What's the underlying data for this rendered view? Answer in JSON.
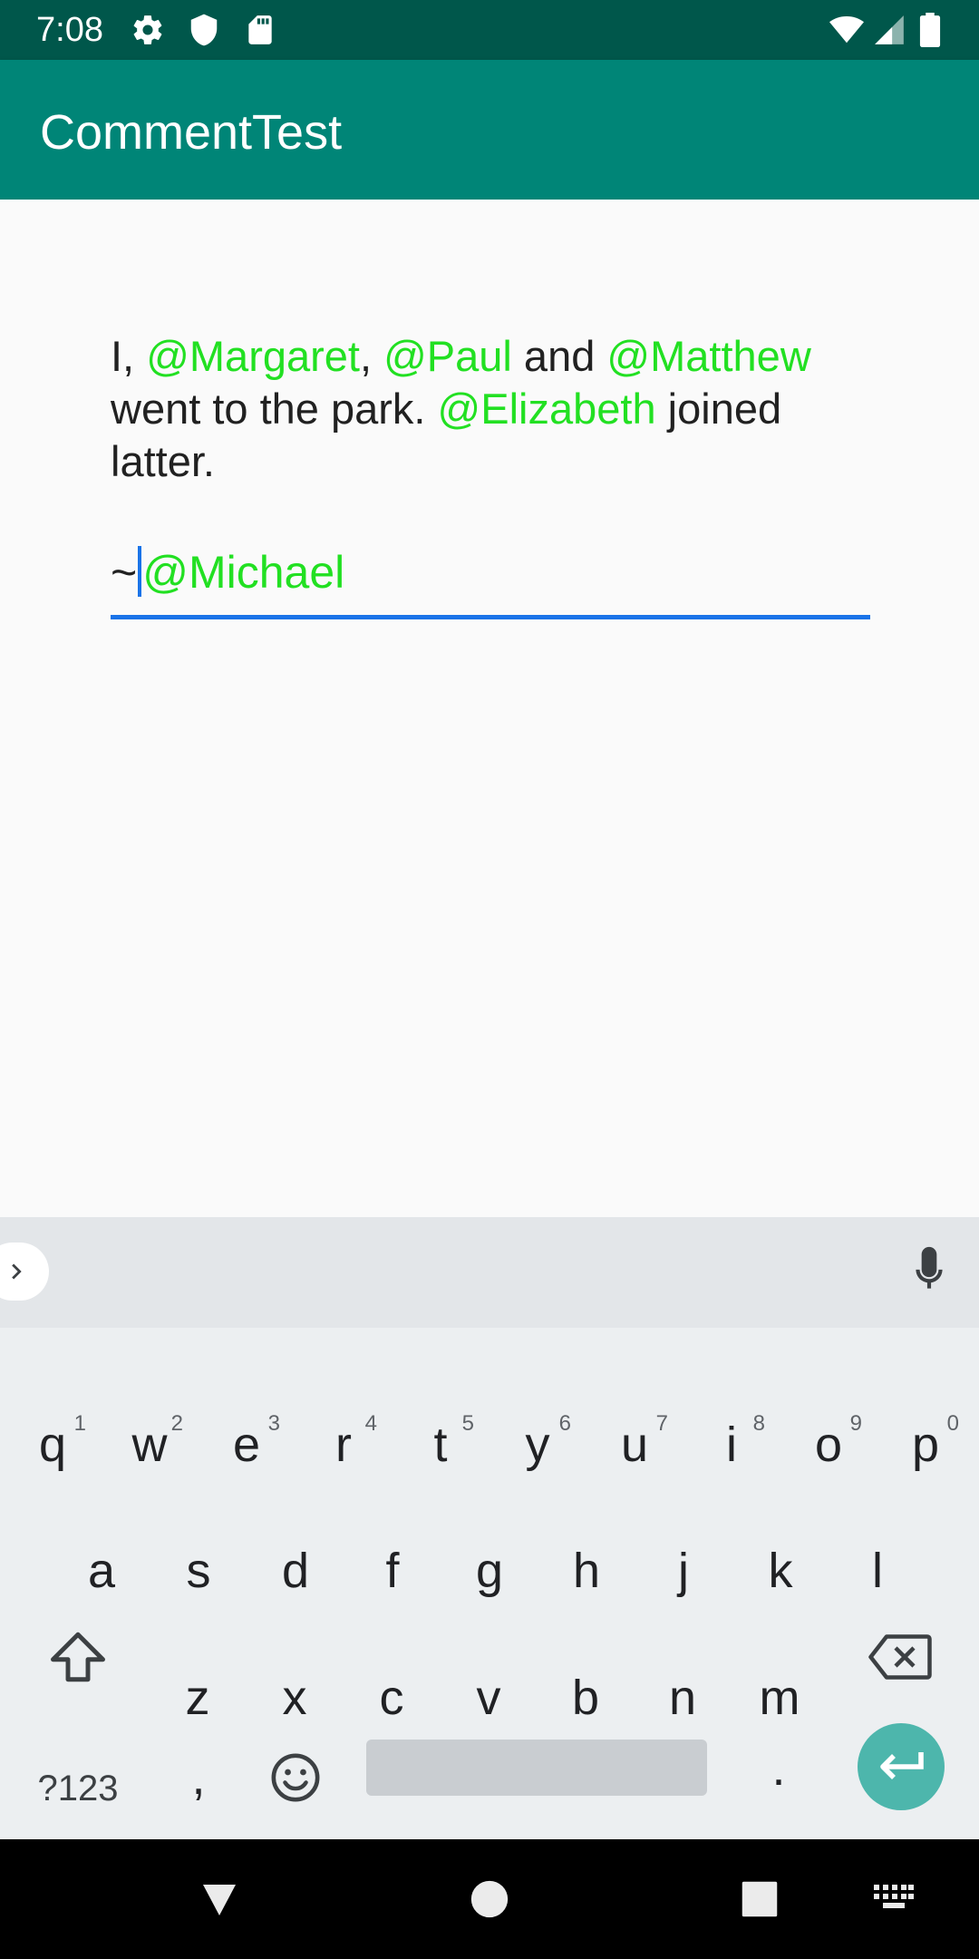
{
  "status_bar": {
    "time": "7:08",
    "left_icons": [
      "settings-icon",
      "shield-icon",
      "sd-card-icon"
    ],
    "right_icons": [
      "wifi-icon",
      "cellular-signal-icon",
      "battery-icon"
    ]
  },
  "app_bar": {
    "title": "CommentTest"
  },
  "comment": {
    "segments": [
      {
        "text": "I, ",
        "mention": false
      },
      {
        "text": "@Margaret",
        "mention": true
      },
      {
        "text": ", ",
        "mention": false
      },
      {
        "text": "@Paul",
        "mention": true
      },
      {
        "text": " and ",
        "mention": false
      },
      {
        "text": "@Matthew",
        "mention": true
      },
      {
        "text": " went to the park. ",
        "mention": false
      },
      {
        "text": "@Elizabeth",
        "mention": true
      },
      {
        "text": " joined latter.",
        "mention": false
      }
    ]
  },
  "input": {
    "prefix": "~",
    "mention": "@Michael"
  },
  "keyboard": {
    "row1": [
      {
        "key": "q",
        "hint": "1"
      },
      {
        "key": "w",
        "hint": "2"
      },
      {
        "key": "e",
        "hint": "3"
      },
      {
        "key": "r",
        "hint": "4"
      },
      {
        "key": "t",
        "hint": "5"
      },
      {
        "key": "y",
        "hint": "6"
      },
      {
        "key": "u",
        "hint": "7"
      },
      {
        "key": "i",
        "hint": "8"
      },
      {
        "key": "o",
        "hint": "9"
      },
      {
        "key": "p",
        "hint": "0"
      }
    ],
    "row2": [
      "a",
      "s",
      "d",
      "f",
      "g",
      "h",
      "j",
      "k",
      "l"
    ],
    "row3": [
      "z",
      "x",
      "c",
      "v",
      "b",
      "n",
      "m"
    ],
    "symbols_label": "?123",
    "comma_label": ",",
    "period_label": ".",
    "icons": [
      "expand-arrow-icon",
      "microphone-icon",
      "shift-icon",
      "backspace-icon",
      "emoji-icon",
      "enter-icon"
    ]
  },
  "nav_bar": {
    "icons": [
      "back-icon",
      "home-icon",
      "recents-icon",
      "keyboard-switch-icon"
    ]
  },
  "colors": {
    "status_bar": "#00574b",
    "app_bar": "#008577",
    "mention": "#22e022",
    "input_underline": "#1a73e8",
    "enter_key": "#4db6ac"
  }
}
